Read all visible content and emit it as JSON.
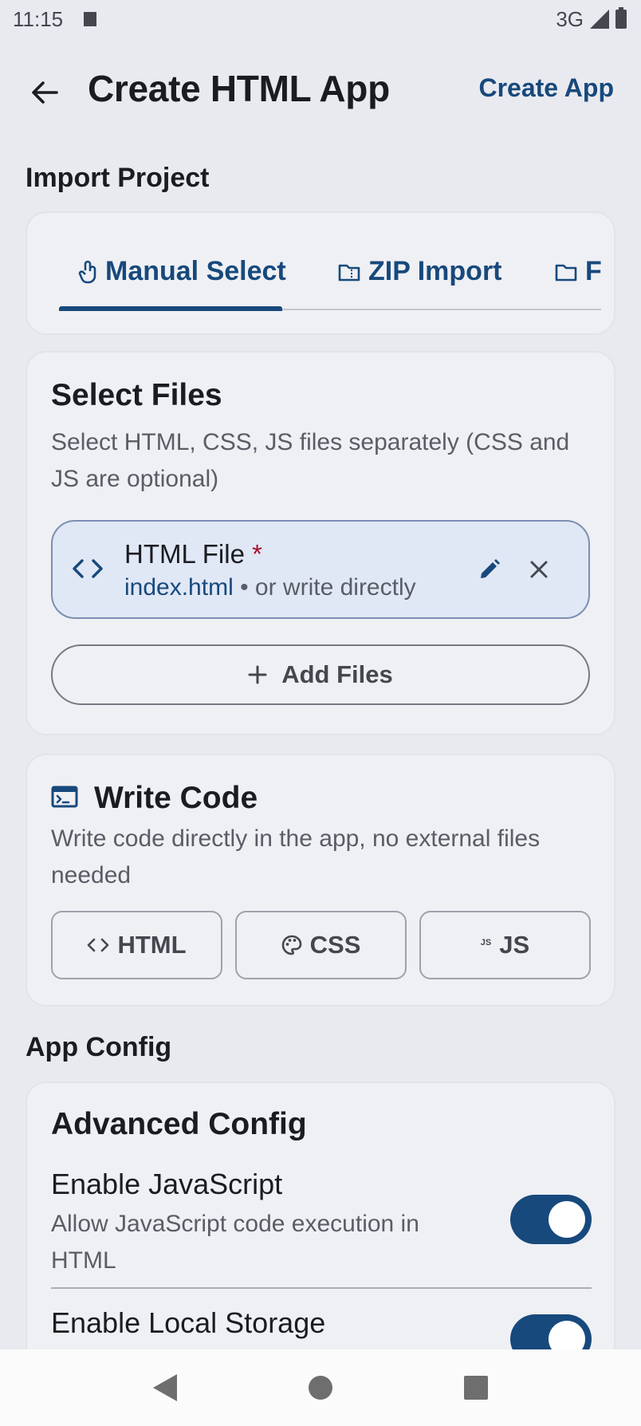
{
  "status_bar": {
    "time": "11:15",
    "network": "3G"
  },
  "app_bar": {
    "title": "Create HTML App",
    "action_label": "Create App"
  },
  "import_section": {
    "label": "Import Project",
    "tabs": [
      {
        "label": "Manual Select",
        "icon": "touch-icon",
        "selected": true
      },
      {
        "label": "ZIP Import",
        "icon": "zip-folder-icon",
        "selected": false
      },
      {
        "label": "F",
        "icon": "folder-icon",
        "selected": false
      }
    ]
  },
  "select_files": {
    "title": "Select Files",
    "description": "Select HTML, CSS, JS files separately (CSS and JS are optional)",
    "file": {
      "label": "HTML File",
      "required_mark": "*",
      "filename": "index.html",
      "hint": " • or write directly"
    },
    "add_files_label": "Add Files"
  },
  "write_code": {
    "title": "Write Code",
    "description": "Write code directly in the app, no external files needed",
    "buttons": [
      {
        "label": "HTML",
        "icon": "code-icon"
      },
      {
        "label": "CSS",
        "icon": "palette-icon"
      },
      {
        "label": "JS",
        "icon": "js-icon",
        "icon_text": "JS"
      }
    ]
  },
  "app_config": {
    "label": "App Config",
    "card_title": "Advanced Config",
    "toggles": [
      {
        "title": "Enable JavaScript",
        "description": "Allow JavaScript code execution in HTML",
        "on": true
      },
      {
        "title": "Enable Local Storage",
        "description": "",
        "on": true
      }
    ]
  },
  "colors": {
    "accent": "#17497c",
    "background": "#e9eaef",
    "required": "#a5122a"
  }
}
